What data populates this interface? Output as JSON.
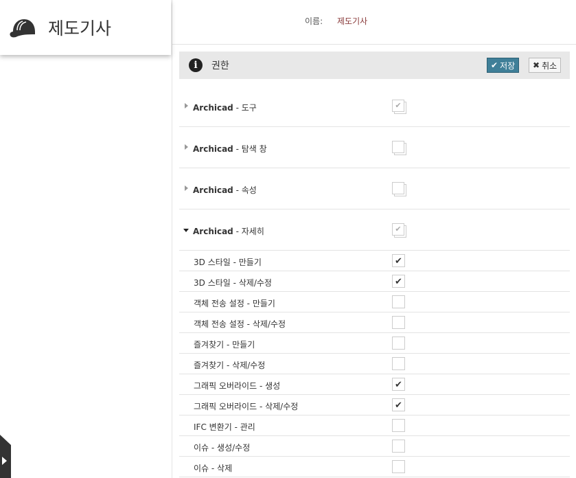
{
  "role": {
    "title": "제도기사",
    "icon": "hard-hat-icon"
  },
  "name_field": {
    "label": "이름:",
    "value": "제도기사"
  },
  "section": {
    "title": "권한",
    "save_label": "저장",
    "cancel_label": "취소"
  },
  "groups": [
    {
      "app": "Archicad",
      "name": " - 도구",
      "expanded": false,
      "state": "partial"
    },
    {
      "app": "Archicad",
      "name": " - 탐색 창",
      "expanded": false,
      "state": "none"
    },
    {
      "app": "Archicad",
      "name": " - 속성",
      "expanded": false,
      "state": "none"
    },
    {
      "app": "Archicad",
      "name": " - 자세히",
      "expanded": true,
      "state": "partial"
    }
  ],
  "items": [
    {
      "label": "3D 스타일 - 만들기",
      "checked": true
    },
    {
      "label": "3D 스타일 - 삭제/수정",
      "checked": true
    },
    {
      "label": "객체 전송 설정 - 만들기",
      "checked": false
    },
    {
      "label": "객체 전송 설정 - 삭제/수정",
      "checked": false
    },
    {
      "label": "즐겨찾기 - 만들기",
      "checked": false
    },
    {
      "label": "즐겨찾기 - 삭제/수정",
      "checked": false
    },
    {
      "label": "그래픽 오버라이드 - 생성",
      "checked": true
    },
    {
      "label": "그래픽 오버라이드 - 삭제/수정",
      "checked": true
    },
    {
      "label": "IFC 변환기 - 관리",
      "checked": false
    },
    {
      "label": "이슈 - 생성/수정",
      "checked": false
    },
    {
      "label": "이슈 - 삭제",
      "checked": false
    }
  ]
}
